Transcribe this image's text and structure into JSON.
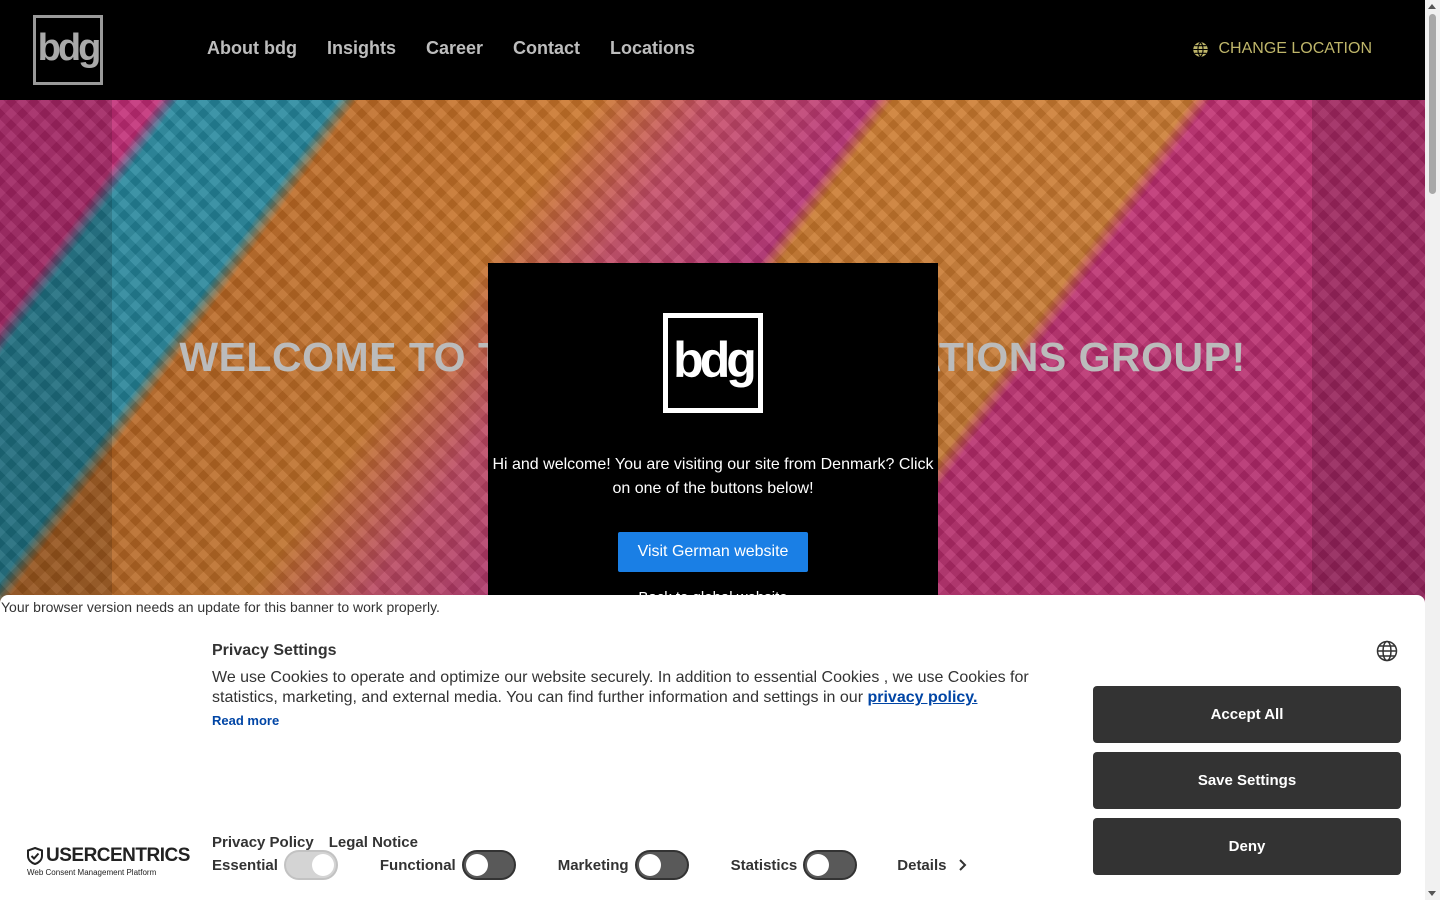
{
  "header": {
    "logo_text": "bdg",
    "nav": [
      {
        "label": "About bdg"
      },
      {
        "label": "Insights"
      },
      {
        "label": "Career"
      },
      {
        "label": "Contact"
      },
      {
        "label": "Locations"
      }
    ],
    "change_location": "CHANGE LOCATION",
    "accent_color": "#bfb66a"
  },
  "hero": {
    "title": "WELCOME TO THE BDG COMMUNICATIONS GROUP!"
  },
  "modal": {
    "logo_text": "bdg",
    "message": "Hi and welcome! You are visiting our site from Denmark? Click on one of the buttons below!",
    "visit_button": "Visit German website",
    "stay_link": "Back to global website",
    "button_color": "#1a7fe5"
  },
  "consent": {
    "browser_note": "Your browser version needs an update for this banner to work properly.",
    "title": "Privacy Settings",
    "text": "We use Cookies to operate and optimize our website securely. In addition to essential Cookies , we use Cookies for statistics, marketing, and external media. You can find further information and settings in our",
    "privacy_link": "privacy policy.",
    "read_more": "Read more",
    "links": {
      "privacy_policy": "Privacy Policy",
      "legal_notice": "Legal Notice"
    },
    "toggles": [
      {
        "label": "Essential",
        "on": true
      },
      {
        "label": "Functional",
        "on": false
      },
      {
        "label": "Marketing",
        "on": false
      },
      {
        "label": "Statistics",
        "on": false
      }
    ],
    "details": "Details",
    "buttons": {
      "accept": "Accept All",
      "save": "Save Settings",
      "deny": "Deny"
    },
    "brand": {
      "name": "USERCENTRICS",
      "tagline": "Web Consent Management Platform"
    }
  }
}
